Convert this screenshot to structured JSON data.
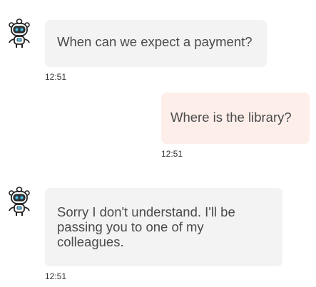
{
  "colors": {
    "bot_bubble": "#f3f3f3",
    "user_bubble": "#fdeeea",
    "text": "#4a4a4a"
  },
  "messages": [
    {
      "sender": "bot",
      "avatar_icon": "robot-icon",
      "text": "When can we expect a payment?",
      "time": "12:51"
    },
    {
      "sender": "user",
      "text": "Where is the library?",
      "time": "12:51"
    },
    {
      "sender": "bot",
      "avatar_icon": "robot-icon",
      "text": "Sorry I don't understand. I'll be passing you to one of my colleagues.",
      "time": "12:51"
    }
  ]
}
